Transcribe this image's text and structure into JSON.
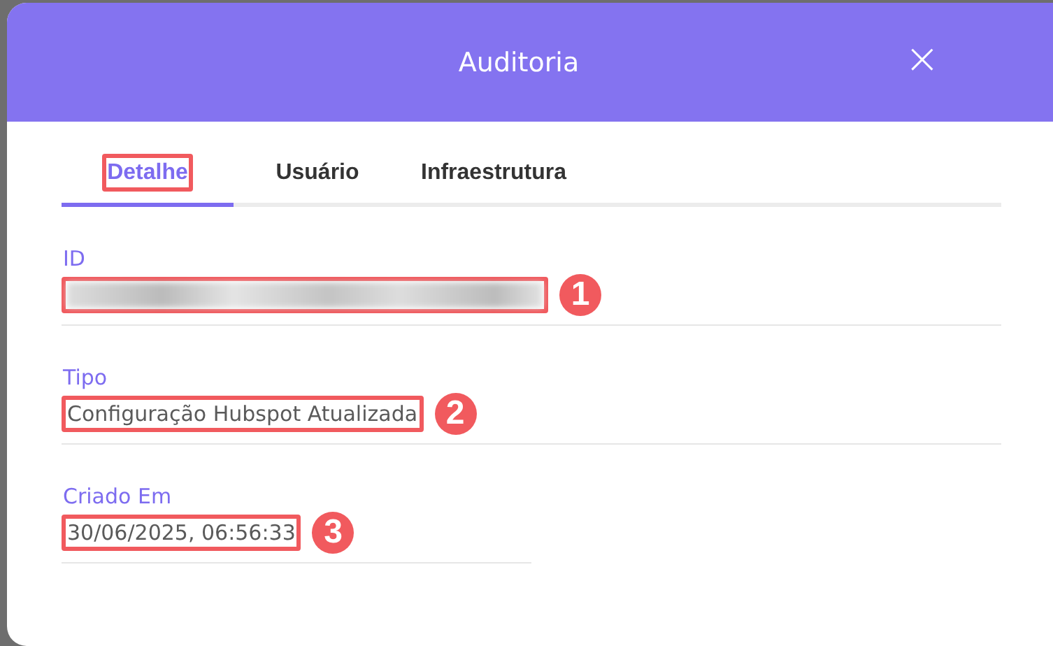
{
  "dialog": {
    "title": "Auditoria",
    "close": "×"
  },
  "tabs": [
    {
      "label": "Detalhe",
      "selected": true,
      "highlighted": true
    },
    {
      "label": "Usuário",
      "selected": false,
      "highlighted": false
    },
    {
      "label": "Infraestrutura",
      "selected": false,
      "highlighted": false
    }
  ],
  "fields": [
    {
      "label": "ID",
      "kind": "redacted",
      "highlighted": true,
      "callout": "1"
    },
    {
      "label": "Tipo",
      "kind": "text",
      "value": "Configuração Hubspot Atualizada",
      "highlighted": true,
      "callout": "2"
    },
    {
      "label": "Criado Em",
      "kind": "text",
      "value": "30/06/2025, 06:56:33",
      "highlighted": true,
      "callout": "3"
    }
  ]
}
